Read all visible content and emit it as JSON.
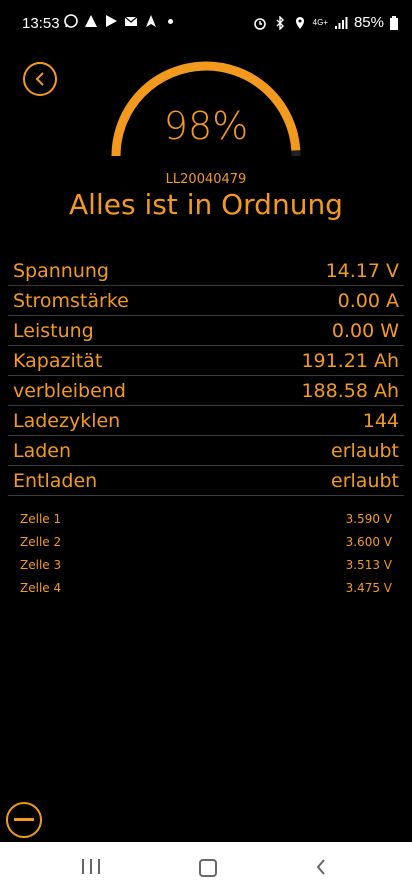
{
  "status_bar": {
    "time": "13:53",
    "battery": "85%",
    "network": "4G+"
  },
  "gauge": {
    "percent": 98,
    "value_text": "98%",
    "color": "#f39a1e"
  },
  "device": {
    "id": "LL20040479",
    "status": "Alles ist in Ordnung"
  },
  "readings": [
    {
      "label": "Spannung",
      "value": "14.17 V"
    },
    {
      "label": "Stromstärke",
      "value": "0.00 A"
    },
    {
      "label": "Leistung",
      "value": "0.00 W"
    },
    {
      "label": "Kapazität",
      "value": "191.21 Ah"
    },
    {
      "label": "verbleibend",
      "value": "188.58 Ah"
    },
    {
      "label": "Ladezyklen",
      "value": "144"
    },
    {
      "label": "Laden",
      "value": "erlaubt"
    },
    {
      "label": "Entladen",
      "value": "erlaubt"
    }
  ],
  "cells": [
    {
      "label": "Zelle 1",
      "value": "3.590 V"
    },
    {
      "label": "Zelle 2",
      "value": "3.600 V"
    },
    {
      "label": "Zelle 3",
      "value": "3.513 V"
    },
    {
      "label": "Zelle 4",
      "value": "3.475 V"
    }
  ]
}
